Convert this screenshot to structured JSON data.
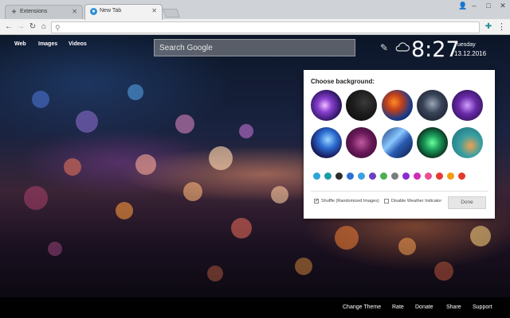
{
  "browser": {
    "tabs": [
      {
        "label": "Extensions",
        "active": false
      },
      {
        "label": "New Tab",
        "active": true
      }
    ],
    "address_value": "",
    "window_controls": [
      "minimize",
      "maximize",
      "close"
    ]
  },
  "nav": {
    "links": [
      "Web",
      "Images",
      "Videos"
    ]
  },
  "search": {
    "placeholder": "Search Google"
  },
  "clock": {
    "time": "8:27",
    "day": "Tuesday",
    "date": "13.12.2016"
  },
  "background_panel": {
    "title": "Choose background:",
    "thumbnails": [
      "purple-light-streak",
      "dark-feather",
      "orange-blue-fractal",
      "grey-smoke",
      "purple-nebula",
      "blue-neon-trail",
      "magenta-lines",
      "blue-light-streaks",
      "green-neon-swirl",
      "teal-orange-blur"
    ],
    "colors": [
      "#2ea3d9",
      "#1f9aa8",
      "#2d2d2d",
      "#2f6fd1",
      "#3aa0e4",
      "#6a3fc2",
      "#4caf50",
      "#7c7c7c",
      "#8a2ad6",
      "#d12ab8",
      "#e84f91",
      "#e53935",
      "#f39c12",
      "#e03a2d"
    ],
    "options": [
      {
        "label": "Shuffle (Randomized Images)",
        "checked": true
      },
      {
        "label": "Disable Weather Indicator",
        "checked": false
      }
    ],
    "done_label": "Done"
  },
  "footer": {
    "links": [
      "Change Theme",
      "Rate",
      "Donate",
      "Share",
      "Support"
    ]
  }
}
